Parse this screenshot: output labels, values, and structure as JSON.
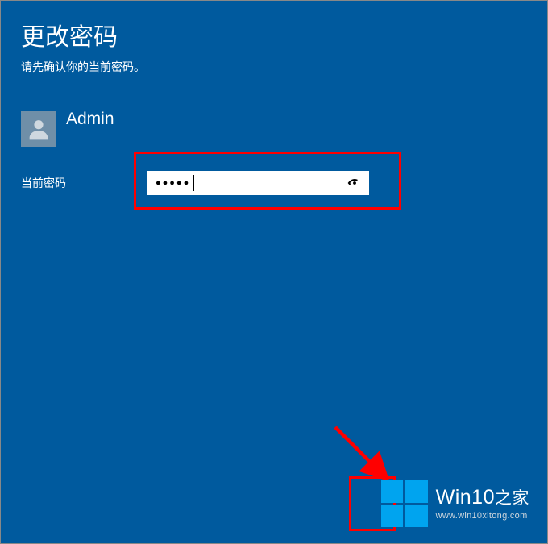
{
  "page": {
    "title": "更改密码",
    "subtitle": "请先确认你的当前密码。"
  },
  "user": {
    "name": "Admin"
  },
  "form": {
    "current_password_label": "当前密码",
    "password_masked": "●●●●●"
  },
  "watermark": {
    "brand_en": "Win10",
    "brand_zh": "之家",
    "url": "www.win10xitong.com"
  }
}
